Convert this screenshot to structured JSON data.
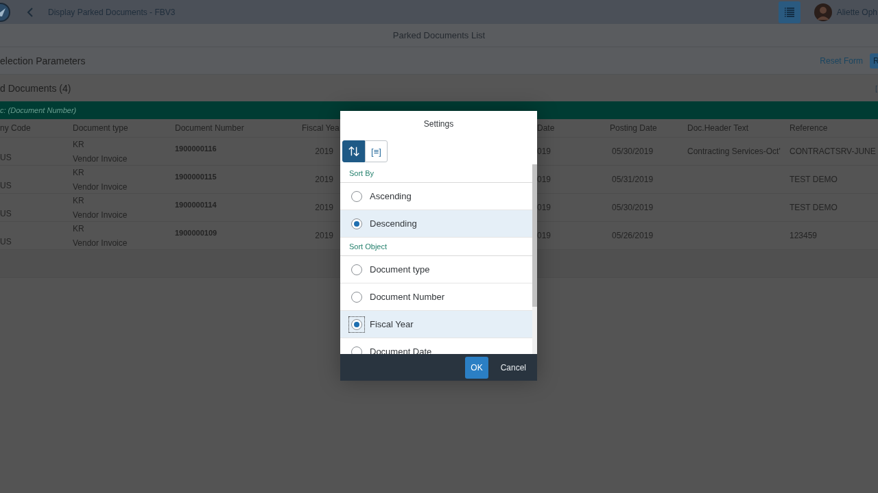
{
  "shell": {
    "title": "Display Parked Documents - FBV3",
    "user": "Aliette Oph"
  },
  "page_title": "Parked Documents List",
  "filter_bar": {
    "title": "election Parameters",
    "reset": "Reset Form",
    "go": "R"
  },
  "table": {
    "title": "d Documents (4)",
    "settings_icon": "[",
    "group_header": "c: (Document Number)",
    "columns": [
      "ny Code",
      "Document type",
      "Document Number",
      "Fiscal Yea",
      "Date",
      "Posting Date",
      "Doc.Header Text",
      "Reference"
    ],
    "rows": [
      {
        "company": "US",
        "type_code": "KR",
        "type": "Vendor Invoice",
        "number": "1900000116",
        "fiscal_year": "2019",
        "doc_date": "019",
        "posting_date": "05/30/2019",
        "header_text": "Contracting Services-Oct'",
        "reference": "CONTRACTSRV-JUNE"
      },
      {
        "company": "US",
        "type_code": "KR",
        "type": "Vendor Invoice",
        "number": "1900000115",
        "fiscal_year": "2019",
        "doc_date": "019",
        "posting_date": "05/31/2019",
        "header_text": "",
        "reference": "TEST DEMO"
      },
      {
        "company": "US",
        "type_code": "KR",
        "type": "Vendor Invoice",
        "number": "1900000114",
        "fiscal_year": "2019",
        "doc_date": "019",
        "posting_date": "05/30/2019",
        "header_text": "",
        "reference": "TEST DEMO"
      },
      {
        "company": "US",
        "type_code": "KR",
        "type": "Vendor Invoice",
        "number": "1900000109",
        "fiscal_year": "2019",
        "doc_date": "019",
        "posting_date": "05/26/2019",
        "header_text": "",
        "reference": "123459"
      }
    ]
  },
  "dialog": {
    "title": "Settings",
    "tabs": [
      {
        "kind": "sort",
        "selected": true
      },
      {
        "kind": "group",
        "label": "[≡]",
        "selected": false
      }
    ],
    "groups": [
      {
        "header": "Sort By",
        "options": [
          {
            "label": "Ascending",
            "selected": false,
            "focused": false
          },
          {
            "label": "Descending",
            "selected": true,
            "focused": false
          }
        ]
      },
      {
        "header": "Sort Object",
        "options": [
          {
            "label": "Document type",
            "selected": false,
            "focused": false
          },
          {
            "label": "Document Number",
            "selected": false,
            "focused": false
          },
          {
            "label": "Fiscal Year",
            "selected": true,
            "focused": true
          },
          {
            "label": "Document Date",
            "selected": false,
            "focused": false
          }
        ]
      }
    ],
    "buttons": [
      {
        "label": "OK",
        "kind": "primary"
      },
      {
        "label": "Cancel",
        "kind": "plain"
      }
    ]
  }
}
